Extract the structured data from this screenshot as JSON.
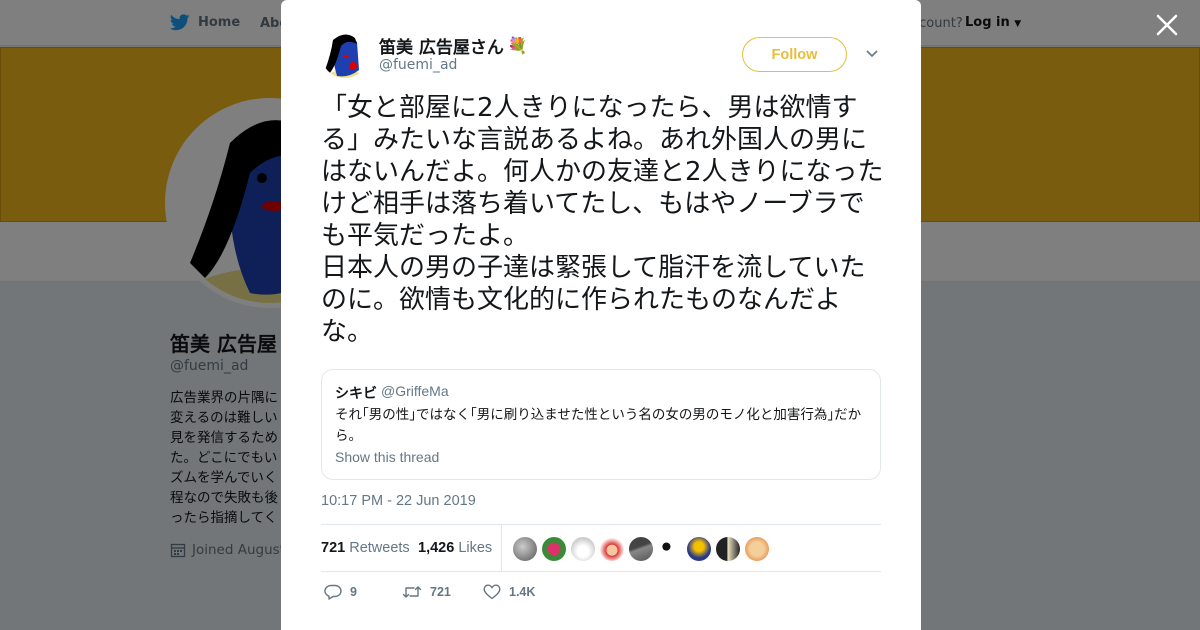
{
  "bg": {
    "nav": {
      "home": "Home",
      "about": "Abo",
      "account_prompt": "ccount?",
      "login": "Log in"
    },
    "profile": {
      "name": "笛美 広告屋",
      "handle": "@fuemi_ad",
      "bio": "広告業界の片隅に\n変えるのは難しい\n見を発信するため\nた。どこにでもい\nズムを学んでいく\n程なので失敗も後\nったら指摘してく",
      "joined": "Joined August"
    },
    "colors": {
      "banner": "#f5b91c",
      "overlay": "rgba(0,0,0,0.5)"
    }
  },
  "tweet": {
    "author_name": "笛美 広告屋さん",
    "author_emoji": "💐",
    "author_handle": "@fuemi_ad",
    "follow_label": "Follow",
    "text": "「女と部屋に2人きりになったら、男は欲情する」みたいな言説あるよね。あれ外国人の男にはないんだよ。何人かの友達と2人きりになったけど相手は落ち着いてたし、もはやノーブラでも平気だったよ。\n日本人の男の子達は緊張して脂汗を流していたのに。欲情も文化的に作られたものなんだよな。",
    "quote": {
      "name": "シキビ",
      "handle": "@GriffeMa",
      "text": "それ｢男の性｣ではなく｢男に刷り込ませた性という名の女の男のモノ化と加害行為｣だから。",
      "show_thread": "Show this thread"
    },
    "timestamp": "10:17 PM - 22 Jun 2019",
    "retweets_count": "721",
    "retweets_label": "Retweets",
    "likes_count": "1,426",
    "likes_label": "Likes",
    "actions": {
      "replies": "9",
      "retweets": "721",
      "likes": "1.4K"
    },
    "accent_color": "#e8bd3c"
  },
  "icons": [
    "twitter-bird-icon",
    "calendar-icon",
    "close-icon",
    "chevron-down-icon",
    "reply-icon",
    "retweet-icon",
    "heart-icon"
  ]
}
